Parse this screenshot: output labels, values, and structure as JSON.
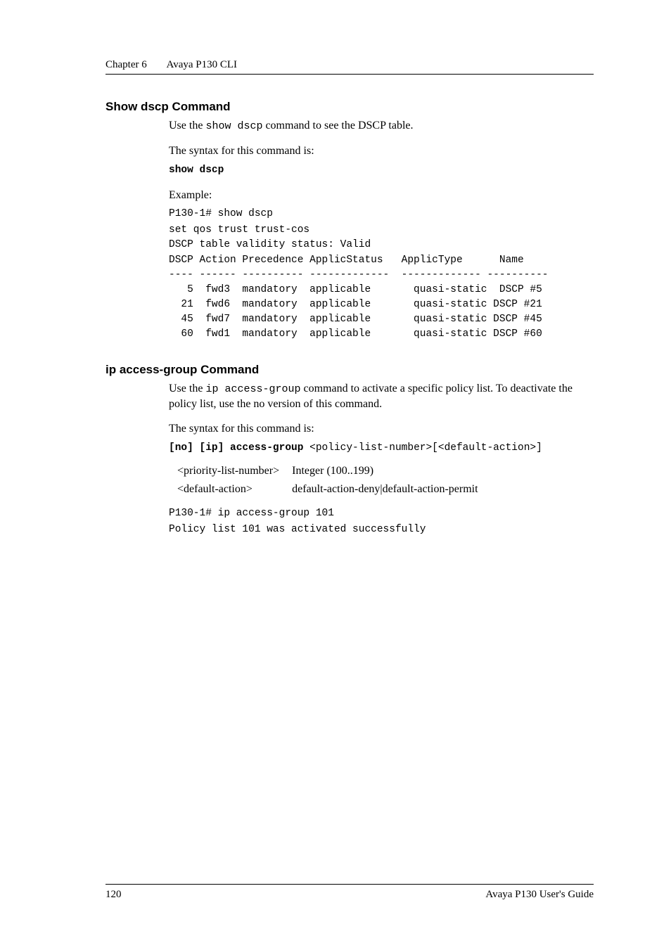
{
  "header": {
    "chapter": "Chapter 6",
    "title": "Avaya P130 CLI"
  },
  "sections": {
    "show_dscp": {
      "heading": "Show dscp Command",
      "intro_pre": "Use the ",
      "intro_cmd": "show dscp",
      "intro_post": " command to see the DSCP table.",
      "syntax_label": "The syntax for this command is:",
      "syntax_cmd": "show dscp",
      "example_label": "Example:",
      "example_cmdline": "P130-1# show dscp",
      "example_output": "set qos trust trust-cos\nDSCP table validity status: Valid\nDSCP Action Precedence ApplicStatus   ApplicType      Name\n---- ------ ---------- -------------  ------------- ----------\n   5  fwd3  mandatory  applicable       quasi-static  DSCP #5\n  21  fwd6  mandatory  applicable       quasi-static DSCP #21\n  45  fwd7  mandatory  applicable       quasi-static DSCP #45\n  60  fwd1  mandatory  applicable       quasi-static DSCP #60"
    },
    "ip_access_group": {
      "heading": " ip access-group Command",
      "intro_pre": "Use the ",
      "intro_cmd": "ip access-group",
      "intro_post": " command to activate a specific policy list. To deactivate the policy list, use the no version of this command.",
      "syntax_label": "The syntax for this command is:",
      "syntax_cmd_bold": "[no] [ip] access-group",
      "syntax_cmd_rest": " <policy-list-number>[<default-action>]",
      "params": [
        {
          "name": "<priority-list-number>",
          "desc": "Integer (100..199)"
        },
        {
          "name": "<default-action>",
          "desc": "default-action-deny|default-action-permit"
        }
      ],
      "example_cmdline": "P130-1# ip access-group 101",
      "example_output": "Policy list 101 was activated successfully"
    }
  },
  "footer": {
    "page": "120",
    "guide": "Avaya P130 User's Guide"
  }
}
